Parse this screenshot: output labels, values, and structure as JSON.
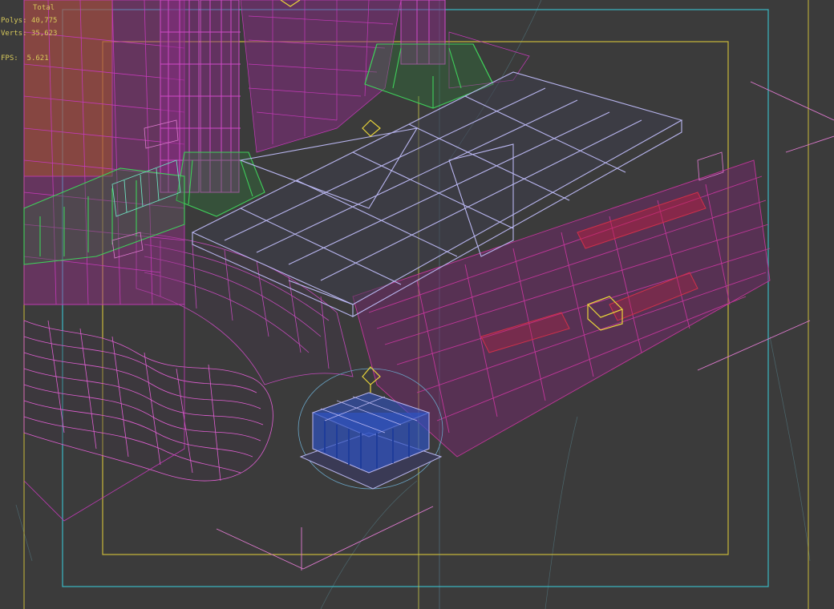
{
  "viewport": {
    "background": "#3b3b3b",
    "colors": {
      "safe_frame_outer": "#39b8c4",
      "safe_frame_inner": "#c8b83a",
      "platform_wire": "#b9b6f0",
      "ground_wire": "#e05fd2",
      "pillar_wire": "#c43ab8",
      "base_wire": "#3fcf5a",
      "barrier_wire": "#c2369a",
      "barrier_red": "#d0304a",
      "dome_wire": "#b9b6f0",
      "dome_fill": "#2f52c0",
      "gizmo": "#e8d43a"
    }
  },
  "stats": {
    "header": "Total",
    "polys_label": "Polys:",
    "polys_value": "40,775",
    "verts_label": "Verts:",
    "verts_value": "35,623",
    "fps_label": "FPS:",
    "fps_value": "5.621"
  }
}
